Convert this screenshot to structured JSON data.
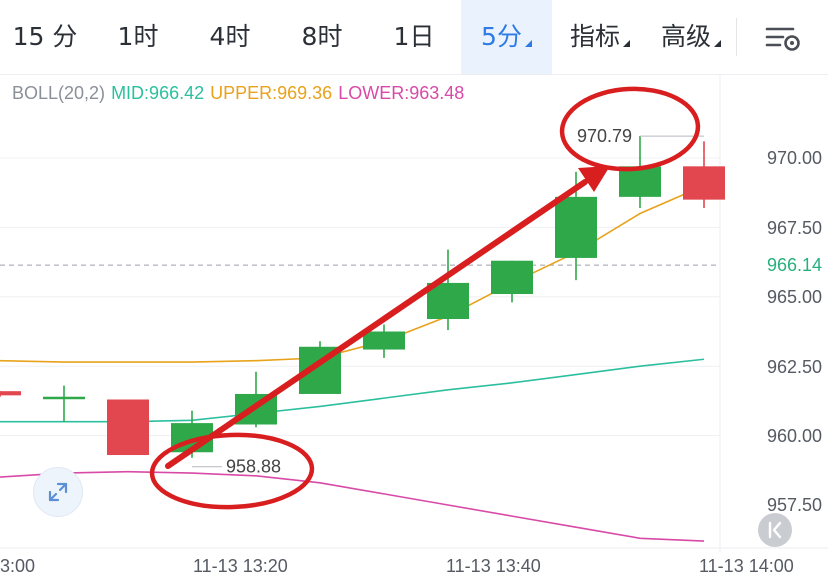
{
  "tabs": [
    {
      "label": "15 分",
      "active": false,
      "dropdown": false
    },
    {
      "label": "1时",
      "active": false,
      "dropdown": false
    },
    {
      "label": "4时",
      "active": false,
      "dropdown": false
    },
    {
      "label": "8时",
      "active": false,
      "dropdown": false
    },
    {
      "label": "1日",
      "active": false,
      "dropdown": false
    },
    {
      "label": "5分",
      "active": true,
      "dropdown": true
    },
    {
      "label": "指标",
      "active": false,
      "dropdown": true
    },
    {
      "label": "高级",
      "active": false,
      "dropdown": true
    }
  ],
  "indicator": {
    "name": "BOLL(20,2)",
    "mid": "MID:966.42",
    "upper": "UPPER:969.36",
    "lower": "LOWER:963.48"
  },
  "price_axis": [
    "970.00",
    "967.50",
    "965.00",
    "962.50",
    "960.00",
    "957.50"
  ],
  "current_price": "966.14",
  "time_axis": [
    "3:00",
    "11-13 13:20",
    "11-13 13:40",
    "11-13 14:00"
  ],
  "annotations": {
    "high_label": "970.79",
    "low_label": "958.88"
  },
  "colors": {
    "up": "#2fa84a",
    "down": "#e2474f",
    "accent": "#2e7be6",
    "mid_line": "#2bbf9e",
    "upper_line": "#e8a21c",
    "lower_line": "#d84aa7",
    "markup": "#d81e1e"
  },
  "icons": {
    "settings": "chart-settings-icon",
    "expand": "expand-icon",
    "collapse": "collapse-left-icon"
  },
  "chart_data": {
    "type": "candlestick",
    "candles": [
      {
        "open": 961.6,
        "close": 961.45,
        "high": 961.6,
        "low": 961.4
      },
      {
        "open": 961.4,
        "close": 961.4,
        "high": 961.8,
        "low": 960.5
      },
      {
        "open": 961.3,
        "close": 959.3,
        "high": 961.3,
        "low": 959.3
      },
      {
        "open": 959.4,
        "close": 960.45,
        "high": 960.9,
        "low": 959.2
      },
      {
        "open": 960.4,
        "close": 961.5,
        "high": 962.3,
        "low": 960.3
      },
      {
        "open": 961.5,
        "close": 963.2,
        "high": 963.4,
        "low": 961.5
      },
      {
        "open": 963.1,
        "close": 963.75,
        "high": 964.0,
        "low": 962.8
      },
      {
        "open": 964.2,
        "close": 965.5,
        "high": 966.7,
        "low": 963.8
      },
      {
        "open": 965.1,
        "close": 966.3,
        "high": 966.3,
        "low": 964.8
      },
      {
        "open": 966.4,
        "close": 968.6,
        "high": 969.5,
        "low": 965.6
      },
      {
        "open": 968.6,
        "close": 969.7,
        "high": 970.79,
        "low": 968.2
      },
      {
        "open": 969.7,
        "close": 968.5,
        "high": 970.6,
        "low": 968.2
      }
    ],
    "mid_line": [
      960.5,
      960.5,
      960.5,
      960.55,
      960.8,
      961.05,
      961.35,
      961.65,
      961.9,
      962.2,
      962.5,
      962.75
    ],
    "upper_line": [
      962.7,
      962.65,
      962.65,
      962.65,
      962.7,
      962.8,
      963.4,
      964.3,
      965.5,
      966.6,
      968.0,
      969.0
    ],
    "lower_line": [
      958.5,
      958.65,
      958.7,
      958.65,
      958.55,
      958.3,
      957.9,
      957.5,
      957.1,
      956.7,
      956.3,
      956.2
    ],
    "current_price": 966.14,
    "ylim": [
      956.0,
      971.5
    ]
  }
}
